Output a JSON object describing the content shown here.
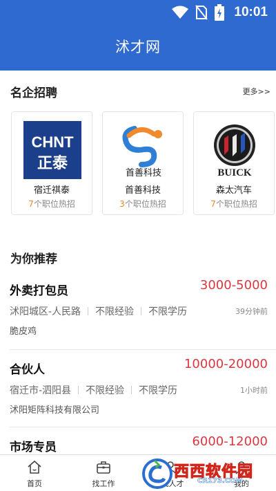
{
  "status_bar": {
    "time": "10:01"
  },
  "app_bar": {
    "title": "沭才网"
  },
  "featured_section": {
    "title": "名企招聘",
    "more_label": "更多>>",
    "companies": [
      {
        "name": "宿迁祺泰",
        "job_count": "7",
        "jobs_suffix": "个职位热招",
        "logo_icon": "chnt-logo",
        "logo_line1": "CHNT",
        "logo_line2": "正泰"
      },
      {
        "name": "首善科技",
        "job_count": "3",
        "jobs_suffix": "个职位热招",
        "logo_icon": "shoushan-logo",
        "logo_text": "首善科技"
      },
      {
        "name": "森太汽车",
        "job_count": "7",
        "jobs_suffix": "个职位热招",
        "logo_icon": "buick-logo",
        "logo_text": "BUICK"
      }
    ]
  },
  "recommend_section": {
    "title": "为你推荐",
    "jobs": [
      {
        "title": "外卖打包员",
        "salary": "3000-5000",
        "location": "沭阳城区-人民路",
        "experience": "不限经验",
        "education": "不限学历",
        "time": "39分钟前",
        "company": "脆皮鸡"
      },
      {
        "title": "合伙人",
        "salary": "10000-20000",
        "location": "宿迁市-泗阳县",
        "experience": "不限经验",
        "education": "不限学历",
        "time": "1小时前",
        "company": "沭阳矩阵科技有限公司"
      },
      {
        "title": "市场专员",
        "salary": "6000-12000"
      }
    ]
  },
  "tab_bar": {
    "tabs": [
      {
        "label": "首页",
        "icon": "home-icon"
      },
      {
        "label": "找工作",
        "icon": "briefcase-icon"
      },
      {
        "label": "找人才",
        "icon": "people-icon"
      },
      {
        "label": "我的",
        "icon": "user-icon"
      }
    ]
  },
  "watermark": {
    "text": "西西软件园",
    "sub": "CR173.COM"
  },
  "colors": {
    "primary": "#2f6ad0",
    "salary": "#d9383e",
    "job_count": "#e88a2a"
  }
}
